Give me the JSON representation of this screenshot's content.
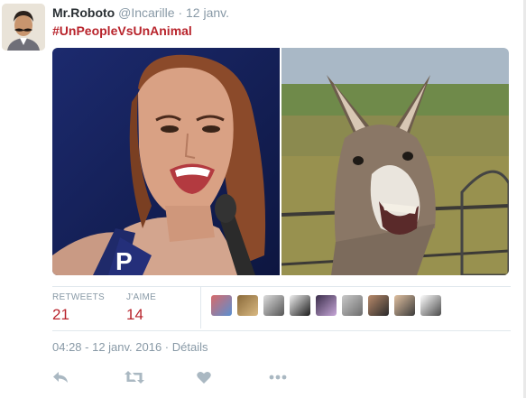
{
  "tweet": {
    "author_name": "Mr.Roboto",
    "author_handle": "@Incarille",
    "separator": "·",
    "time": "12 janv.",
    "hashtag": "#UnPeopleVsUnAnimal"
  },
  "stats": {
    "retweets_label": "RETWEETS",
    "retweets_value": "21",
    "likes_label": "J'AIME",
    "likes_value": "14"
  },
  "timestamp": "04:28 - 12 janv. 2016 · Détails",
  "actions": [
    "reply-icon",
    "retweet-icon",
    "heart-icon",
    "more-icon"
  ],
  "colors": {
    "accent": "#b8242c",
    "muted": "#8899a6",
    "border": "#e1e8ed",
    "icon": "#aab8c2"
  },
  "likers_count_shown": 9
}
